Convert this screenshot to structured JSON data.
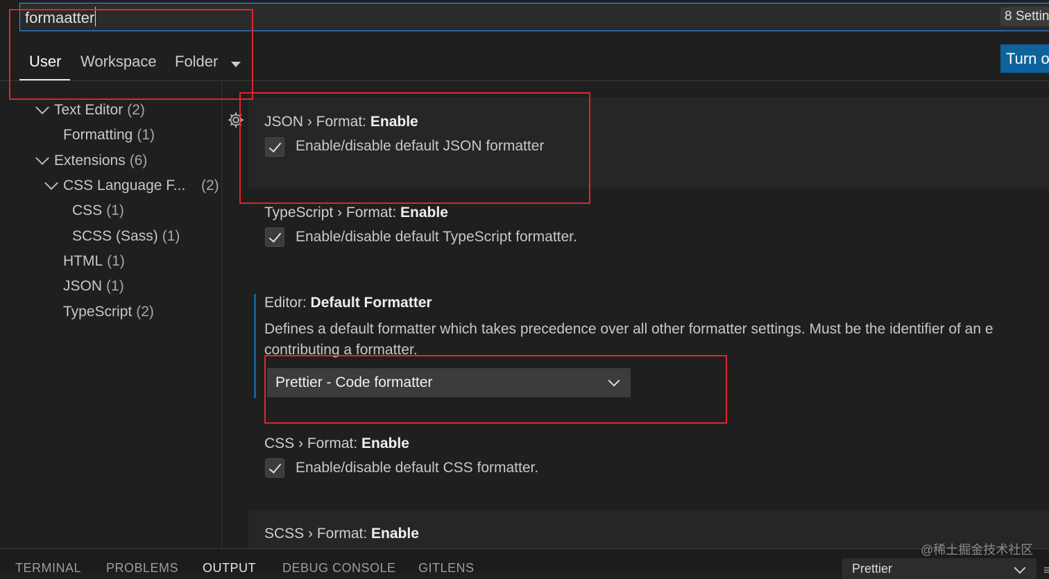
{
  "search": {
    "value": "formaatter",
    "results_count": "8 Settin"
  },
  "tabs": [
    {
      "label": "User",
      "active": true
    },
    {
      "label": "Workspace"
    },
    {
      "label": "Folder"
    }
  ],
  "turn_on_button": "Turn o",
  "toc": [
    {
      "label": "Text Editor",
      "count": "(2)"
    },
    {
      "label": "Formatting",
      "count": "(1)"
    },
    {
      "label": "Extensions",
      "count": "(6)"
    },
    {
      "label": "CSS Language F...",
      "count": "(2)"
    },
    {
      "label": "CSS",
      "count": "(1)"
    },
    {
      "label": "SCSS (Sass)",
      "count": "(1)"
    },
    {
      "label": "HTML",
      "count": "(1)"
    },
    {
      "label": "JSON",
      "count": "(1)"
    },
    {
      "label": "TypeScript",
      "count": "(2)"
    }
  ],
  "settings": {
    "json": {
      "prefix": "JSON › Format: ",
      "name": "Enable",
      "description": "Enable/disable default JSON formatter",
      "checked": true
    },
    "typescript": {
      "prefix": "TypeScript › Format: ",
      "name": "Enable",
      "description": "Enable/disable default TypeScript formatter.",
      "checked": true
    },
    "formatter": {
      "prefix": "Editor: ",
      "name": "Default Formatter",
      "description_line1": "Defines a default formatter which takes precedence over all other formatter settings. Must be the identifier of an e",
      "description_line2": "contributing a formatter.",
      "value": "Prettier - Code formatter"
    },
    "css": {
      "prefix": "CSS › Format: ",
      "name": "Enable",
      "description": "Enable/disable default CSS formatter.",
      "checked": true
    },
    "scss": {
      "prefix": "SCSS › Format: ",
      "name": "Enable"
    }
  },
  "panel": {
    "tabs": [
      "TERMINAL",
      "PROBLEMS",
      "OUTPUT",
      "DEBUG CONSOLE",
      "GITLENS"
    ],
    "active_tab": "OUTPUT",
    "channel": "Prettier"
  },
  "watermark": "@稀土掘金技术社区",
  "colors": {
    "accent": "#0e639c",
    "focus_border": "#3794ff",
    "annotation": "#e0262b"
  }
}
